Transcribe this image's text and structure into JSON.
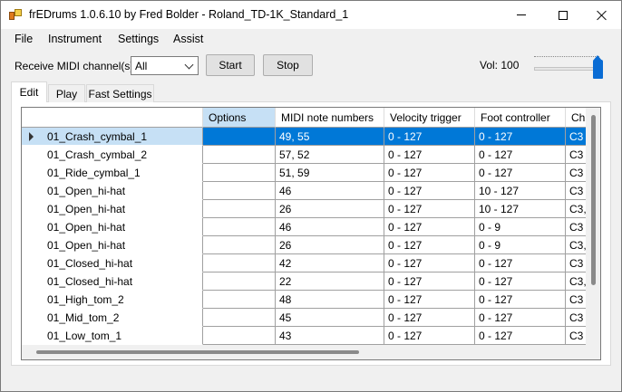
{
  "window": {
    "title": "frEDrums 1.0.6.10 by Fred Bolder - Roland_TD-1K_Standard_1"
  },
  "menu": [
    "File",
    "Instrument",
    "Settings",
    "Assist"
  ],
  "toolbar": {
    "channel_label": "Receive MIDI channel(s)",
    "channel_value": "All",
    "start_label": "Start",
    "stop_label": "Stop",
    "volume_label": "Vol: 100",
    "volume_level": 1.0
  },
  "tabs": [
    "Edit",
    "Play",
    "Fast Settings"
  ],
  "grid": {
    "columns": [
      "Options",
      "MIDI note numbers",
      "Velocity trigger",
      "Foot controller",
      "Ch"
    ],
    "rows": [
      {
        "name": "01_Crash_cymbal_1",
        "options": "",
        "notes": "49, 55",
        "velocity": "0 - 127",
        "foot": "0 - 127",
        "ch": "C3"
      },
      {
        "name": "01_Crash_cymbal_2",
        "options": "",
        "notes": "57, 52",
        "velocity": "0 - 127",
        "foot": "0 - 127",
        "ch": "C3"
      },
      {
        "name": "01_Ride_cymbal_1",
        "options": "",
        "notes": "51, 59",
        "velocity": "0 - 127",
        "foot": "0 - 127",
        "ch": "C3"
      },
      {
        "name": "01_Open_hi-hat",
        "options": "",
        "notes": "46",
        "velocity": "0 - 127",
        "foot": "10 - 127",
        "ch": "C3"
      },
      {
        "name": "01_Open_hi-hat",
        "options": "",
        "notes": "26",
        "velocity": "0 - 127",
        "foot": "10 - 127",
        "ch": "C3,"
      },
      {
        "name": "01_Open_hi-hat",
        "options": "",
        "notes": "46",
        "velocity": "0 - 127",
        "foot": "0 - 9",
        "ch": "C3"
      },
      {
        "name": "01_Open_hi-hat",
        "options": "",
        "notes": "26",
        "velocity": "0 - 127",
        "foot": "0 - 9",
        "ch": "C3,"
      },
      {
        "name": "01_Closed_hi-hat",
        "options": "",
        "notes": "42",
        "velocity": "0 - 127",
        "foot": "0 - 127",
        "ch": "C3"
      },
      {
        "name": "01_Closed_hi-hat",
        "options": "",
        "notes": "22",
        "velocity": "0 - 127",
        "foot": "0 - 127",
        "ch": "C3,"
      },
      {
        "name": "01_High_tom_2",
        "options": "",
        "notes": "48",
        "velocity": "0 - 127",
        "foot": "0 - 127",
        "ch": "C3"
      },
      {
        "name": "01_Mid_tom_2",
        "options": "",
        "notes": "45",
        "velocity": "0 - 127",
        "foot": "0 - 127",
        "ch": "C3"
      },
      {
        "name": "01_Low_tom_1",
        "options": "",
        "notes": "43",
        "velocity": "0 - 127",
        "foot": "0 - 127",
        "ch": "C3"
      }
    ],
    "selected_row": 0
  }
}
